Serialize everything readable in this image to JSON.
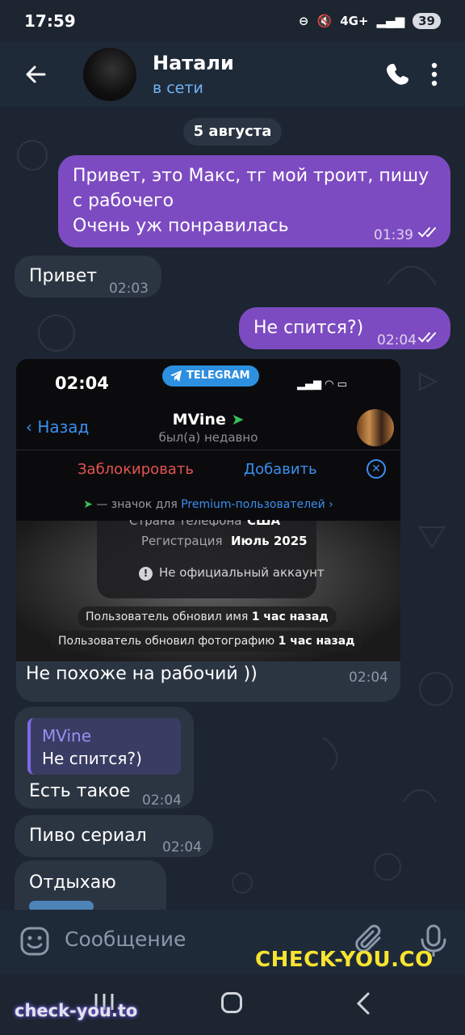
{
  "status_bar": {
    "time": "17:59",
    "network": "4G+",
    "battery": "39"
  },
  "header": {
    "name": "Натали",
    "status": "в сети"
  },
  "chat": {
    "date": "5 августа",
    "messages": [
      {
        "direction": "out",
        "lines": [
          "Привет, это Макс, тг мой троит, пишу",
          "с рабочего",
          "Очень уж понравилась"
        ],
        "time": "01:39"
      },
      {
        "direction": "in",
        "text": "Привет",
        "time": "02:03"
      },
      {
        "direction": "out",
        "text": "Не спится?)",
        "time": "02:04"
      },
      {
        "direction": "in",
        "type": "photo",
        "caption": "Не похоже на рабочий ))",
        "time": "02:04"
      },
      {
        "direction": "in",
        "reply_to": {
          "author": "MVine",
          "text": "Не спится?)"
        },
        "text": "Есть такое",
        "time": "02:04"
      },
      {
        "direction": "in",
        "text": "Пиво сериал",
        "time": "02:04"
      },
      {
        "direction": "in",
        "text": "Отдыхаю",
        "time": ""
      }
    ]
  },
  "screenshot_photo": {
    "badge": "TELEGRAM",
    "time": "02:04",
    "back_label": "Назад",
    "profile_name": "MVine",
    "profile_status": "был(а) недавно",
    "block_label": "Заблокировать",
    "add_label": "Добавить",
    "premium_text": "— значок для",
    "premium_link": "Premium-пользователей",
    "phone_country_label": "Страна телефона",
    "phone_country_value": "США",
    "registration_label": "Регистрация",
    "registration_value": "Июль 2025",
    "unofficial_label": "Не официальный аккаунт",
    "name_updated_prefix": "Пользователь обновил имя",
    "name_updated_when": "1 час назад",
    "photo_updated_prefix": "Пользователь обновил фотографию",
    "photo_updated_when": "1 час назад"
  },
  "composer": {
    "placeholder": "Сообщение"
  },
  "watermarks": {
    "main": "CHECK-YOU.CO",
    "corner": "check-you.to"
  },
  "colors": {
    "outgoing": "#7d4bc1",
    "incoming": "#2b3542",
    "accent": "#6fb4f3",
    "header": "#1f2a38"
  }
}
